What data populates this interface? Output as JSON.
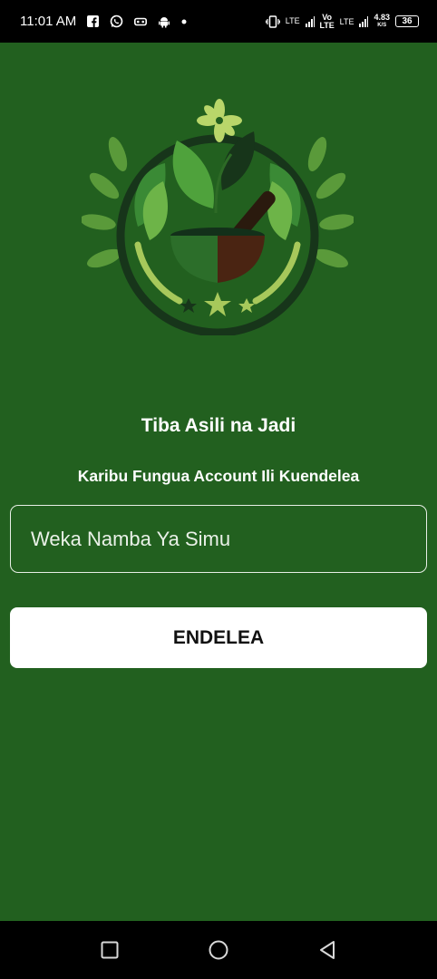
{
  "status_bar": {
    "time": "11:01 AM",
    "network_speed": "4.83",
    "network_speed_unit": "K/S",
    "battery": "36",
    "lte_label_1": "LTE",
    "lte_label_2": "Vo LTE",
    "lte_label_3": "LTE"
  },
  "app": {
    "title": "Tiba Asili na Jadi",
    "subtitle": "Karibu Fungua Account Ili Kuendelea"
  },
  "phone_input": {
    "placeholder": "Weka Namba Ya Simu",
    "value": ""
  },
  "continue_button": {
    "label": "ENDELEA"
  },
  "colors": {
    "background": "#22601f",
    "button_bg": "#ffffff"
  }
}
